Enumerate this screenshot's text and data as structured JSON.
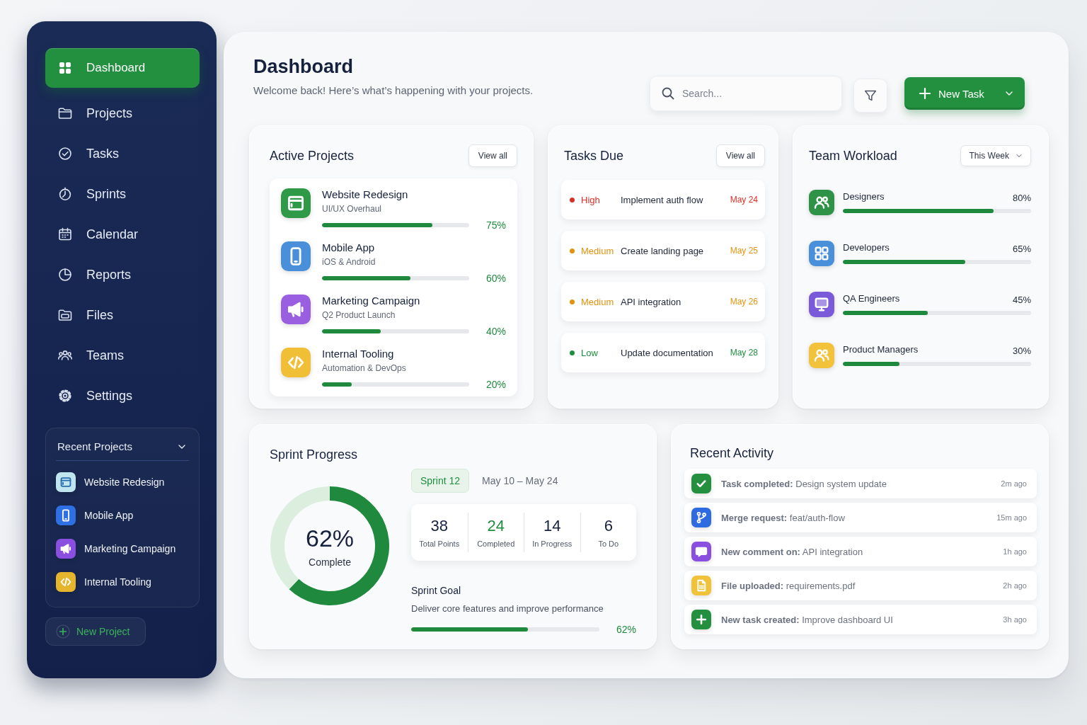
{
  "sidebar": {
    "nav_items": [
      {
        "label": "Dashboard",
        "selected": true
      },
      {
        "label": "Projects",
        "selected": false
      },
      {
        "label": "Tasks",
        "selected": false
      },
      {
        "label": "Sprints",
        "selected": false
      },
      {
        "label": "Calendar",
        "selected": false
      },
      {
        "label": "Reports",
        "selected": false
      },
      {
        "label": "Files",
        "selected": false
      },
      {
        "label": "Teams",
        "selected": false
      },
      {
        "label": "Settings",
        "selected": false
      }
    ],
    "recent_projects": {
      "title": "Recent Projects",
      "expanded": true,
      "items": [
        {
          "name": "Website Redesign",
          "color": "#bfe5ee"
        },
        {
          "name": "Mobile App",
          "color": "#2f6fe4"
        },
        {
          "name": "Marketing Campaign",
          "color": "#8a4fe0"
        },
        {
          "name": "Internal Tooling",
          "color": "#e5b52e"
        }
      ]
    },
    "new_project_button": "New Project"
  },
  "header": {
    "title": "Dashboard",
    "subtitle": "Welcome back! Here’s what’s happening with your projects.",
    "search": {
      "placeholder": "Search..."
    },
    "new_task_button": "New Task"
  },
  "active_projects": {
    "title": "Active Projects",
    "view_all": "View all",
    "projects": [
      {
        "name": "Website Redesign",
        "subtitle": "UI/UX Overhaul",
        "level": 0.75,
        "reading": "75%",
        "color": "#2e9a48"
      },
      {
        "name": "Mobile App",
        "subtitle": "iOS & Android",
        "level": 0.6,
        "reading": "60%",
        "color": "#4a8fd9"
      },
      {
        "name": "Marketing Campaign",
        "subtitle": "Q2 Product Launch",
        "level": 0.4,
        "reading": "40%",
        "color": "#9a5ee0"
      },
      {
        "name": "Internal Tooling",
        "subtitle": "Automation & DevOps",
        "level": 0.2,
        "reading": "20%",
        "color": "#f0bf35"
      }
    ]
  },
  "tasks_due": {
    "title": "Tasks Due",
    "view_all": "View all",
    "tasks": [
      {
        "priority": "High",
        "title": "Implement auth flow",
        "due": "May 24",
        "color": "#d93025"
      },
      {
        "priority": "Medium",
        "title": "Create landing page",
        "due": "May 25",
        "color": "#e3920e"
      },
      {
        "priority": "Medium",
        "title": "API integration",
        "due": "May 26",
        "color": "#e3920e"
      },
      {
        "priority": "Low",
        "title": "Update documentation",
        "due": "May 28",
        "color": "#1e8e3e"
      }
    ]
  },
  "team_workload": {
    "title": "Team Workload",
    "period": "This Week",
    "teams": [
      {
        "name": "Designers",
        "level": 0.8,
        "reading": "80%",
        "color": "#2e9347"
      },
      {
        "name": "Developers",
        "level": 0.65,
        "reading": "65%",
        "color": "#4a8fd9"
      },
      {
        "name": "QA Engineers",
        "level": 0.45,
        "reading": "45%",
        "color": "#7a5ad8"
      },
      {
        "name": "Product Managers",
        "level": 0.3,
        "reading": "30%",
        "color": "#f2c23a"
      }
    ]
  },
  "sprint_progress": {
    "title": "Sprint Progress",
    "chart_data": {
      "type": "donut",
      "values": [
        62,
        38
      ]
    },
    "reading": "62%",
    "caption": "Complete",
    "sprint": "Sprint 12",
    "dates": "May 10 – May 24",
    "stats": [
      {
        "value": "38",
        "label": "Total Points",
        "color": "#16213d"
      },
      {
        "value": "24",
        "label": "Completed",
        "color": "#1e8e3e"
      },
      {
        "value": "14",
        "label": "In Progress",
        "color": "#16213d"
      },
      {
        "value": "6",
        "label": "To Do",
        "color": "#16213d"
      }
    ],
    "goal": {
      "title": "Sprint Goal",
      "description": "Deliver core features and improve performance",
      "level": 0.62,
      "reading": "62%"
    }
  },
  "recent_activity": {
    "title": "Recent Activity",
    "items": [
      {
        "text": "**Task completed:** Design system update",
        "time": "2m ago",
        "color": "#24903f"
      },
      {
        "text": "**Merge request:** feat/auth-flow",
        "time": "15m ago",
        "color": "#2f6be0"
      },
      {
        "text": "**New comment on:** API integration",
        "time": "1h ago",
        "color": "#8b4fe0"
      },
      {
        "text": "**File uploaded:** requirements.pdf",
        "time": "2h ago",
        "color": "#f0c23a"
      },
      {
        "text": "**New task created:** Improve dashboard UI",
        "time": "3h ago",
        "color": "#24903f"
      }
    ]
  }
}
